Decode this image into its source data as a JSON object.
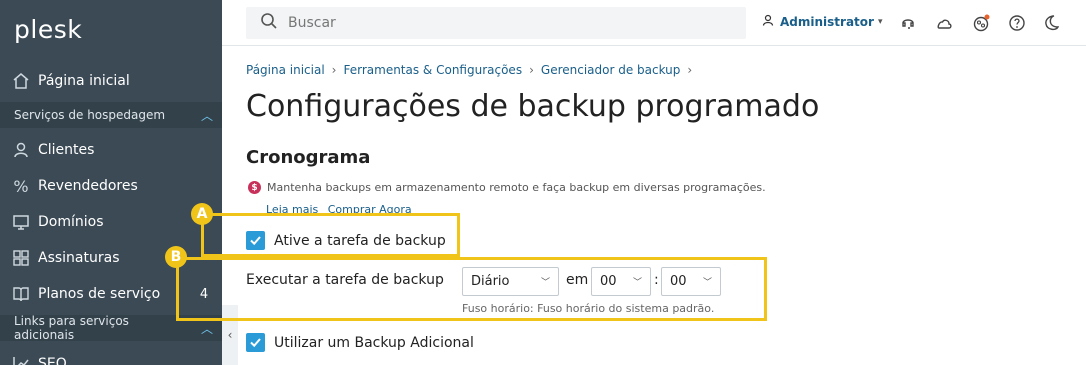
{
  "sidebar": {
    "logo": "plesk",
    "home": {
      "label": "Página inicial",
      "icon": "home-icon"
    },
    "section_hosting": {
      "label": "Serviços de hospedagem"
    },
    "items": [
      {
        "label": "Clientes",
        "icon": "user-icon",
        "count": ""
      },
      {
        "label": "Revendedores",
        "icon": "percent-icon",
        "count": ""
      },
      {
        "label": "Domínios",
        "icon": "monitor-icon",
        "count": ""
      },
      {
        "label": "Assinaturas",
        "icon": "grid-icon",
        "count": ""
      },
      {
        "label": "Planos de serviço",
        "icon": "book-icon",
        "count": "4"
      }
    ],
    "section_links": {
      "label": "Links para serviços adicionais"
    },
    "seo": {
      "label": "SEO",
      "icon": "chart-icon"
    }
  },
  "topbar": {
    "search_placeholder": "Buscar",
    "user_label": "Administrator",
    "icons": [
      "support-icon",
      "cloud-icon",
      "extensions-icon",
      "help-icon",
      "dark-mode-icon"
    ]
  },
  "breadcrumb": [
    "Página inicial",
    "Ferramentas & Configurações",
    "Gerenciador de backup"
  ],
  "page_title": "Configurações de backup programado",
  "section_title": "Cronograma",
  "promo": {
    "badge": "$",
    "text": "Mantenha backups em armazenamento remoto e faça backup em diversas programações.",
    "link_more": "Leia mais",
    "link_buy": "Comprar Agora"
  },
  "form": {
    "activate_label": "Ative a tarefa de backup",
    "run_label": "Executar a tarefa de backup",
    "frequency": "Diário",
    "at_label": "em",
    "hour": "00",
    "colon": ":",
    "minute": "00",
    "timezone_hint": "Fuso horário: Fuso horário do sistema padrão.",
    "additional_label": "Utilizar um Backup Adicional"
  },
  "callouts": {
    "a": "A",
    "b": "B"
  },
  "colors": {
    "sidebar_bg": "#3b4a55",
    "accent": "#2b9bd8",
    "link": "#1a5f8a",
    "callout": "#f0c419"
  }
}
